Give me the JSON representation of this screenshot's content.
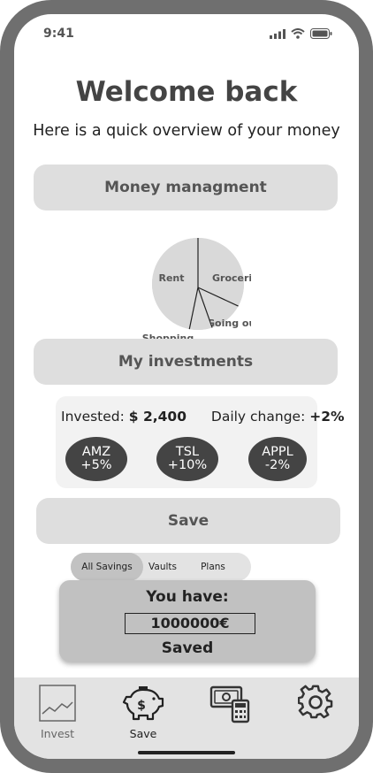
{
  "status_bar": {
    "time": "9:41"
  },
  "header": {
    "title": "Welcome back",
    "subtitle": "Here is a quick overview of your money"
  },
  "sections": {
    "money_management": "Money managment",
    "investments": "My investments",
    "save": "Save"
  },
  "chart_data": {
    "type": "pie",
    "categories": [
      "Rent",
      "Groceries",
      "Going out",
      "Shopping"
    ],
    "values": [
      0.47,
      0.33,
      0.12,
      0.08
    ],
    "title": "",
    "legend": "none"
  },
  "investments": {
    "invested_label": "Invested:",
    "invested_value": "$ 2,400",
    "daily_change_label": "Daily change:",
    "daily_change_value": "+2%",
    "stocks": [
      {
        "ticker": "AMZ",
        "change": "+5%"
      },
      {
        "ticker": "TSL",
        "change": "+10%"
      },
      {
        "ticker": "APPL",
        "change": "-2%"
      }
    ]
  },
  "savings": {
    "tabs": [
      "All Savings",
      "Vaults",
      "Plans"
    ],
    "active_tab": "All Savings",
    "you_have_label": "You have:",
    "amount": "1000000€",
    "saved_label": "Saved"
  },
  "bottom_nav": {
    "items": [
      {
        "label": "Invest",
        "icon": "chart-icon"
      },
      {
        "label": "Save",
        "icon": "piggy-bank-icon"
      },
      {
        "label": "",
        "icon": "money-calculator-icon"
      },
      {
        "label": "",
        "icon": "gear-icon"
      }
    ]
  },
  "colors": {
    "frame": "#6f6f6f",
    "pill": "#dedede",
    "dark": "#444444",
    "bottom_bar": "#e3e3e3"
  }
}
